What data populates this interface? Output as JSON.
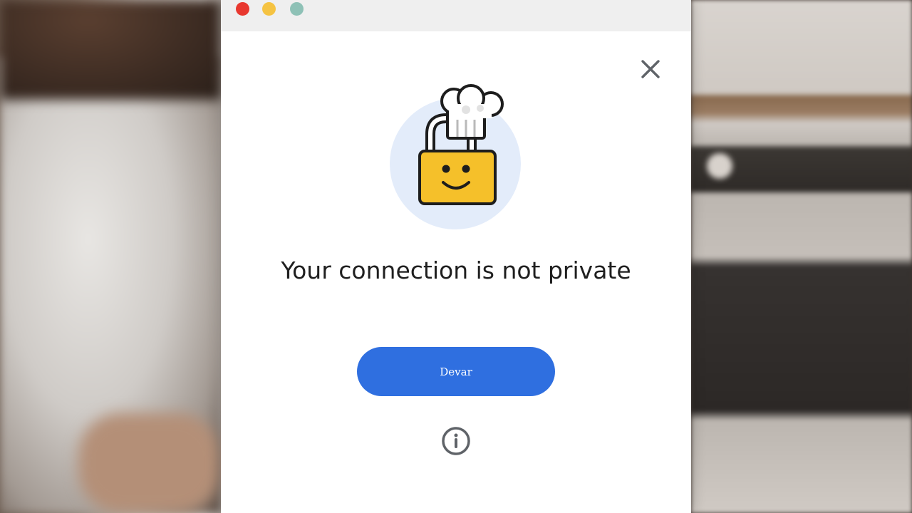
{
  "window": {
    "traffic_lights": {
      "close_color": "#e8382f",
      "minimize_color": "#f5c342",
      "zoom_color": "#8ec1b6"
    }
  },
  "dialog": {
    "close_icon": "close-icon",
    "illustration": "padlock-chef-hat-smiley",
    "heading": "Your connection is not private",
    "primary_button_label": "Devar",
    "info_icon": "info-icon",
    "accent_color": "#2f6fe0",
    "lock_color": "#f5c02a"
  }
}
